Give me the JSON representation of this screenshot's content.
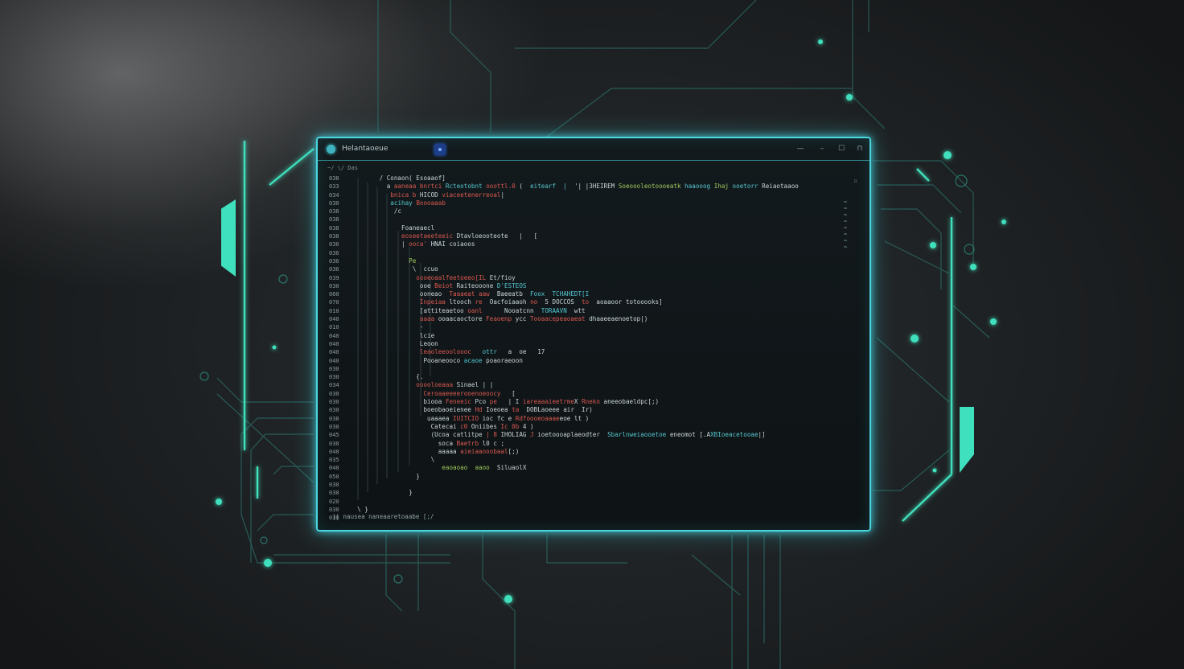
{
  "colors": {
    "accent": "#3fe0bd",
    "window_border": "#49d6e0",
    "keyword_red": "#d9584f",
    "text_green": "#9fc95e",
    "text_cyan": "#55c6cf",
    "text_white": "#c9d4d6"
  },
  "window": {
    "title": "Helantaoeue",
    "controls": {
      "minimize": "—",
      "restore": "–",
      "maximize": "☐",
      "close": "⊓"
    },
    "path": "~/ \\/ Das",
    "corner": "▫",
    "status": "||  nausea naneaaretoaabe [;/"
  },
  "gutter": [
    "038",
    "033",
    "034",
    "030",
    "038",
    "038",
    "038",
    "038",
    "036",
    "036",
    "036",
    "036",
    "039",
    "030",
    "060",
    "070",
    "010",
    "040",
    "010",
    "040",
    "040",
    "040",
    "040",
    "030",
    "030",
    "034",
    "030",
    "030",
    "030",
    "038",
    "030",
    "045",
    "030",
    "040",
    "035",
    "040",
    "050",
    "030",
    "030",
    "020",
    "030",
    "030"
  ],
  "code_lines": [
    [
      {
        "i": "        ",
        "t": "/ Conaon( Esoaaof]",
        "c": "white"
      }
    ],
    [
      {
        "i": "          ",
        "t": "a ",
        "c": "white"
      },
      {
        "t": "aaneaa bnrtci ",
        "c": "red"
      },
      {
        "t": "Rcteotobnt ",
        "c": "cyan"
      },
      {
        "t": "ooottl.0 ",
        "c": "red"
      },
      {
        "t": "(  ",
        "c": "white"
      },
      {
        "t": "eitearf  |  ",
        "c": "cyan"
      },
      {
        "t": "'| |3HEIREM ",
        "c": "white"
      },
      {
        "t": "Soeoooleotoooeatk ",
        "c": "green"
      },
      {
        "t": "haaooog ",
        "c": "cyan"
      },
      {
        "t": "Ihaj ",
        "c": "green"
      },
      {
        "t": "ooetorr ",
        "c": "cyan"
      },
      {
        "t": "Reiaotaaoo",
        "c": "white"
      }
    ],
    [
      {
        "i": "           ",
        "t": "bnica b ",
        "c": "red"
      },
      {
        "t": "HICOD ",
        "c": "white"
      },
      {
        "t": "viaceetenerreoal",
        "c": "red"
      },
      {
        "t": "|",
        "c": "white"
      }
    ],
    [
      {
        "i": "           ",
        "t": "acihay ",
        "c": "cyan"
      },
      {
        "t": "Boooaaab",
        "c": "red"
      }
    ],
    [
      {
        "i": "            ",
        "t": "/c",
        "c": "white"
      }
    ],
    [
      {
        "i": "",
        "t": "",
        "c": "white"
      }
    ],
    [
      {
        "i": "              ",
        "t": "Foaneaecl",
        "c": "white"
      }
    ],
    [
      {
        "i": "              ",
        "t": "eoseetaeeteeic ",
        "c": "red"
      },
      {
        "t": "Dtavloeooteote   |   [",
        "c": "white"
      }
    ],
    [
      {
        "i": "              ",
        "t": "| ",
        "c": "white"
      },
      {
        "t": "ooca' ",
        "c": "red"
      },
      {
        "t": "HNAI coiaoos",
        "c": "white"
      }
    ],
    [
      {
        "i": "",
        "t": "",
        "c": "white"
      }
    ],
    [
      {
        "i": "                ",
        "t": "Pe",
        "c": "green"
      }
    ],
    [
      {
        "i": "                 ",
        "t": "\\  ccuo",
        "c": "white"
      }
    ],
    [
      {
        "i": "                  ",
        "t": "oooeoaalfeetoeeo[IL ",
        "c": "red"
      },
      {
        "t": "Et/fioy",
        "c": "white"
      }
    ],
    [
      {
        "i": "                   ",
        "t": "ooe ",
        "c": "white"
      },
      {
        "t": "Beiot ",
        "c": "red"
      },
      {
        "t": "Raiteooone ",
        "c": "white"
      },
      {
        "t": "D'ESTEOS",
        "c": "cyan"
      }
    ],
    [
      {
        "i": "                   ",
        "t": "ooneao  ",
        "c": "white"
      },
      {
        "t": "Taaaeat aaw  ",
        "c": "red"
      },
      {
        "t": "Baeeatb  ",
        "c": "white"
      },
      {
        "t": "Foox  ",
        "c": "cyan"
      },
      {
        "t": "TCHAHEDT[I",
        "c": "cyan"
      }
    ],
    [
      {
        "i": "                   ",
        "t": "Inpeiaa ",
        "c": "red"
      },
      {
        "t": "ltooch ",
        "c": "white"
      },
      {
        "t": "re  ",
        "c": "red"
      },
      {
        "t": "Oacfoiaaoh ",
        "c": "white"
      },
      {
        "t": "no  ",
        "c": "red"
      },
      {
        "t": "5 DOCCOS  ",
        "c": "white"
      },
      {
        "t": "to  ",
        "c": "red"
      },
      {
        "t": "aoaaoor totooooks]",
        "c": "white"
      }
    ],
    [
      {
        "i": "                   ",
        "t": "[attiteaetoo ",
        "c": "white"
      },
      {
        "t": "oanl ",
        "c": "red"
      },
      {
        "t": "     Nooatcnn ",
        "c": "white"
      },
      {
        "t": " TORAAVN  ",
        "c": "cyan"
      },
      {
        "t": "wtt",
        "c": "white"
      }
    ],
    [
      {
        "i": "                   ",
        "t": "aaaa ",
        "c": "red"
      },
      {
        "t": "ooaacaoctore ",
        "c": "white"
      },
      {
        "t": "Feaoenp ",
        "c": "red"
      },
      {
        "t": "ycc ",
        "c": "white"
      },
      {
        "t": "Tooaacepeaoaeat ",
        "c": "red"
      },
      {
        "t": "dhaaeeaenoetop|)",
        "c": "white"
      }
    ],
    [
      {
        "i": "                   ",
        "t": "-",
        "c": "white"
      }
    ],
    [
      {
        "i": "                   ",
        "t": "lcie",
        "c": "white"
      }
    ],
    [
      {
        "i": "                   ",
        "t": "Leoon",
        "c": "white"
      }
    ],
    [
      {
        "i": "                   ",
        "t": "leaoleeooloooc   ",
        "c": "red"
      },
      {
        "t": "ottr   ",
        "c": "cyan"
      },
      {
        "t": "a  oe   17",
        "c": "white"
      }
    ],
    [
      {
        "i": "                    ",
        "t": "Pooaneooco ",
        "c": "white"
      },
      {
        "t": "acaoe ",
        "c": "cyan"
      },
      {
        "t": "poaoraeoon",
        "c": "white"
      }
    ],
    [
      {
        "i": "",
        "t": "",
        "c": "white"
      }
    ],
    [
      {
        "i": "                  ",
        "t": "{.",
        "c": "white"
      }
    ],
    [
      {
        "i": "                  ",
        "t": "ooooloeaaa ",
        "c": "red"
      },
      {
        "t": "Sinael | |",
        "c": "white"
      }
    ],
    [
      {
        "i": "                    ",
        "t": "Ceroaaeeeerooenoeoocy   ",
        "c": "red"
      },
      {
        "t": "[",
        "c": "white"
      }
    ],
    [
      {
        "i": "                    ",
        "t": "biooa ",
        "c": "white"
      },
      {
        "t": "Feneeic ",
        "c": "red"
      },
      {
        "t": "Pco ",
        "c": "white"
      },
      {
        "t": "pe   ",
        "c": "red"
      },
      {
        "t": "| I ",
        "c": "white"
      },
      {
        "t": "iareaaaieetrme",
        "c": "red"
      },
      {
        "t": "X ",
        "c": "white"
      },
      {
        "t": "Rneko ",
        "c": "red"
      },
      {
        "t": "aneeobaeldpc[;)",
        "c": "white"
      }
    ],
    [
      {
        "i": "                    ",
        "t": "boeobaoeienee ",
        "c": "white"
      },
      {
        "t": "Hd ",
        "c": "red"
      },
      {
        "t": "Ioeoea ",
        "c": "white"
      },
      {
        "t": "ta  ",
        "c": "red"
      },
      {
        "t": "DOBLaoeee ",
        "c": "white"
      },
      {
        "t": "air  Ir)",
        "c": "white"
      }
    ],
    [
      {
        "i": "                     ",
        "t": "uaaaea ",
        "c": "white"
      },
      {
        "t": "IUITCIO ",
        "c": "red"
      },
      {
        "t": "ioc fc e ",
        "c": "white"
      },
      {
        "t": "Rdfoooeoaaae",
        "c": "red"
      },
      {
        "t": "eoe lt )",
        "c": "white"
      }
    ],
    [
      {
        "i": "                      ",
        "t": "Catecai ",
        "c": "white"
      },
      {
        "t": "c0 ",
        "c": "red"
      },
      {
        "t": "Oniibes ",
        "c": "white"
      },
      {
        "t": "Ic 0b ",
        "c": "red"
      },
      {
        "t": "4 )",
        "c": "white"
      }
    ],
    [
      {
        "i": "                      ",
        "t": "(Ucoa catlitpe ",
        "c": "white"
      },
      {
        "t": "| 8 ",
        "c": "red"
      },
      {
        "t": "IHOLIAG ",
        "c": "white"
      },
      {
        "t": "J ",
        "c": "red"
      },
      {
        "t": "ioetoooaplaeodter  ",
        "c": "white"
      },
      {
        "t": "Sbarlnweiaooetoe ",
        "c": "cyan"
      },
      {
        "t": "eneomot [.A",
        "c": "white"
      },
      {
        "t": "XBIoeacetooae",
        "c": "cyan"
      },
      {
        "t": "|]",
        "c": "white"
      }
    ],
    [
      {
        "i": "                        ",
        "t": "soca ",
        "c": "white"
      },
      {
        "t": "Baetrb ",
        "c": "red"
      },
      {
        "t": "l0 c ;",
        "c": "white"
      }
    ],
    [
      {
        "i": "                        ",
        "t": "aaaaa ",
        "c": "white"
      },
      {
        "t": "aieiaaooobaal",
        "c": "red"
      },
      {
        "t": "[;)",
        "c": "white"
      }
    ],
    [
      {
        "i": "                      ",
        "t": "\\",
        "c": "white"
      }
    ],
    [
      {
        "i": "                         ",
        "t": "eaoaoao  aaoo  ",
        "c": "green"
      },
      {
        "t": "Siluaol",
        "c": "white"
      },
      {
        "t": "X",
        "c": "white"
      }
    ],
    [
      {
        "i": "                  ",
        "t": "}",
        "c": "white"
      }
    ],
    [
      {
        "i": "",
        "t": "",
        "c": "white"
      }
    ],
    [
      {
        "i": "                ",
        "t": "}",
        "c": "white"
      }
    ],
    [
      {
        "i": "",
        "t": "",
        "c": "white"
      }
    ],
    [
      {
        "i": "  ",
        "t": "\\ }",
        "c": "white"
      }
    ]
  ]
}
